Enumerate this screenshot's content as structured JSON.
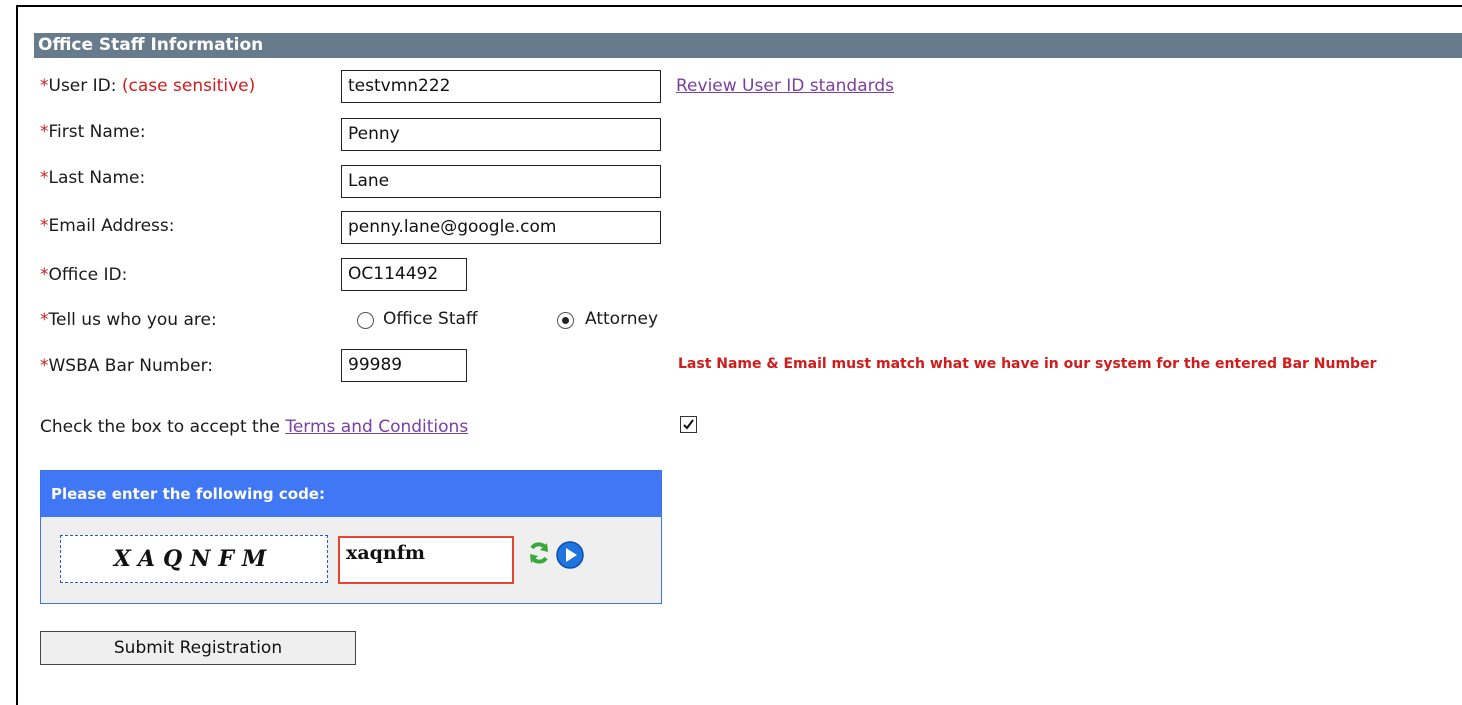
{
  "section": {
    "title": "Office Staff Information"
  },
  "fields": {
    "user_id": {
      "label": "User ID:",
      "hint": "(case sensitive)",
      "value": "testvmn222",
      "link": "Review User ID standards"
    },
    "first_name": {
      "label": "First Name:",
      "value": "Penny"
    },
    "last_name": {
      "label": "Last Name:",
      "value": "Lane"
    },
    "email": {
      "label": "Email Address:",
      "value": "penny.lane@google.com"
    },
    "office_id": {
      "label": "Office ID:",
      "value": "OC114492"
    },
    "who": {
      "label": "Tell us who you are:",
      "options": [
        "Office Staff",
        "Attorney"
      ],
      "selected": "Attorney"
    },
    "bar_number": {
      "label": "WSBA Bar Number:",
      "value": "99989",
      "warning": "Last Name & Email must match what we have in our system for the entered Bar Number"
    }
  },
  "required_marker": "*",
  "terms": {
    "prefix": "Check the box to accept the ",
    "link": "Terms and Conditions",
    "checked": true
  },
  "captcha": {
    "title": "Please enter the following code:",
    "code": "XAQNFM",
    "entered": "xaqnfm"
  },
  "submit_label": "Submit Registration",
  "colors": {
    "header": "#687b8d",
    "required": "#d31b1b",
    "link": "#7a3fa5",
    "captcha_header": "#3f77f5"
  }
}
